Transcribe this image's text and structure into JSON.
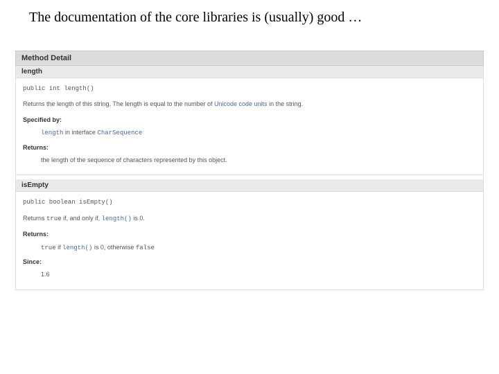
{
  "slide": {
    "title": "The documentation of the core libraries is (usually) good …"
  },
  "javadoc": {
    "section_header": "Method Detail",
    "methods": [
      {
        "name": "length",
        "signature": "public int length()",
        "description_pre": "Returns the length of this string. The length is equal to the number of ",
        "description_link": "Unicode code units",
        "description_post": " in the string.",
        "specified_label": "Specified by:",
        "specified_pre": "length",
        "specified_mid": " in interface ",
        "specified_post": "CharSequence",
        "returns_label": "Returns:",
        "returns_text": "the length of the sequence of characters represented by this object."
      },
      {
        "name": "isEmpty",
        "signature": "public boolean isEmpty()",
        "description_pre": "Returns ",
        "description_code1": "true",
        "description_mid": " if, and only if, ",
        "description_link": "length()",
        "description_post": " is 0.",
        "returns_label": "Returns:",
        "returns_code1": "true",
        "returns_mid1": " if ",
        "returns_link": "length()",
        "returns_mid2": " is 0, otherwise ",
        "returns_code2": "false",
        "since_label": "Since:",
        "since_text": "1.6"
      }
    ]
  }
}
